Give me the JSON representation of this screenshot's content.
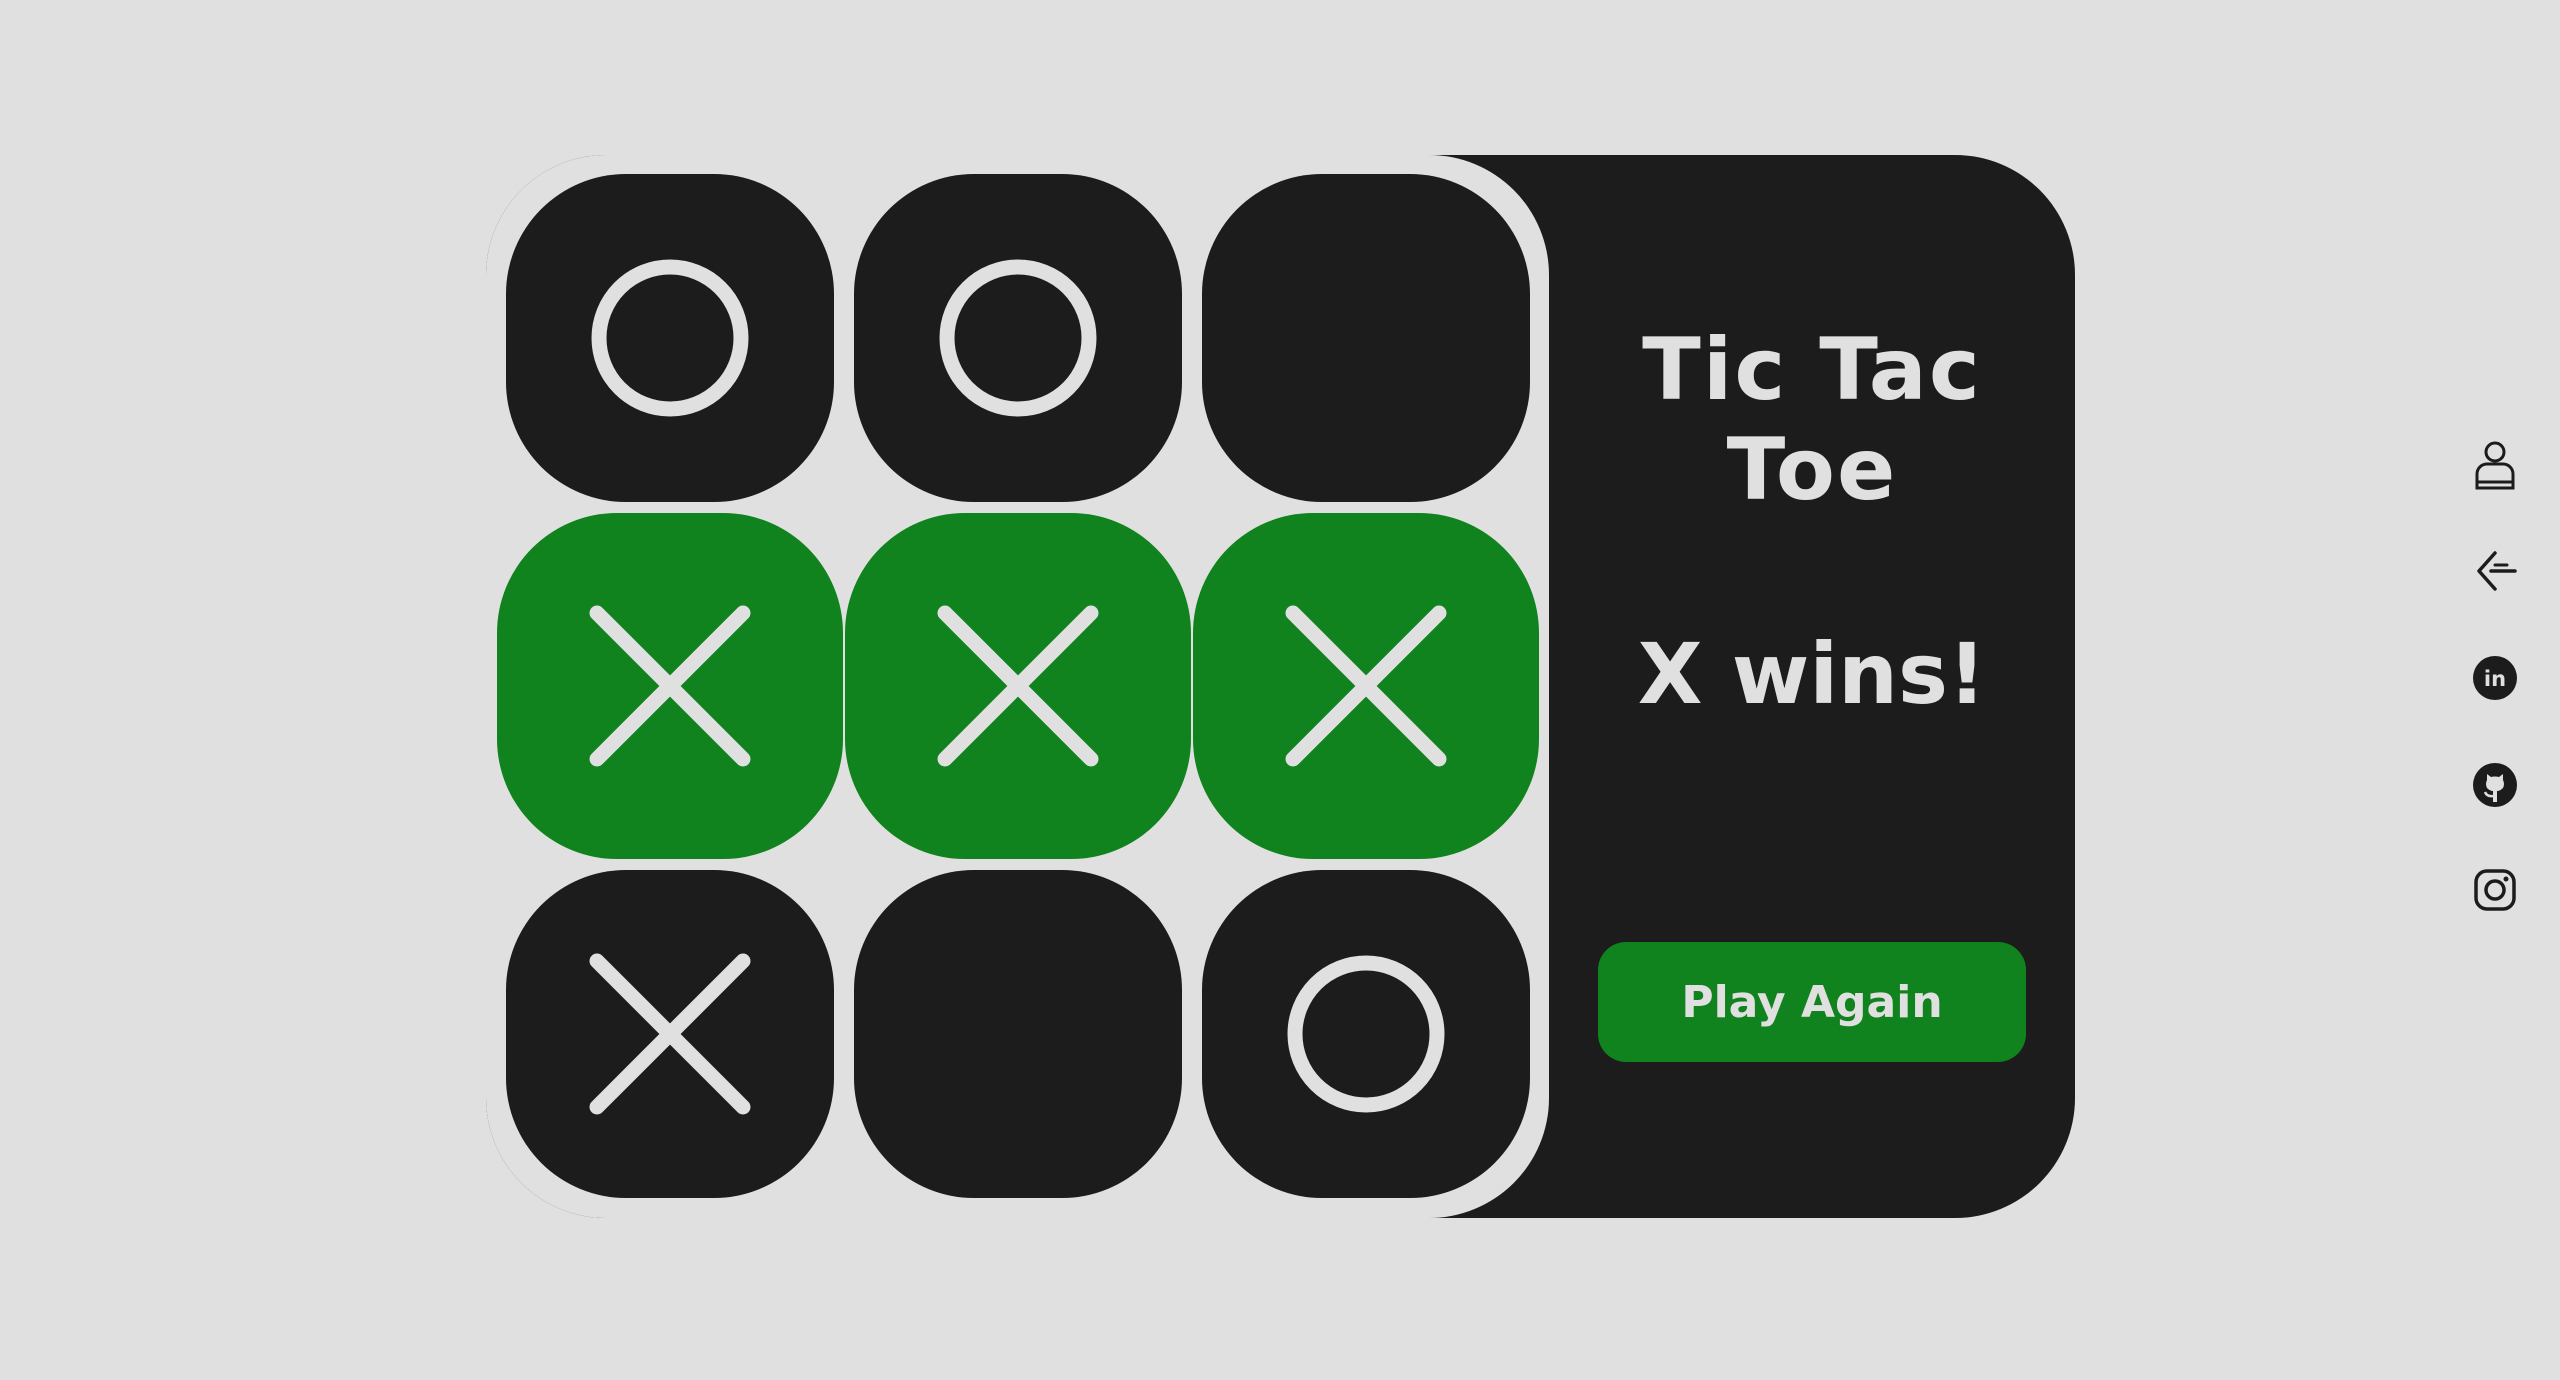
{
  "game": {
    "title": "Tic Tac Toe",
    "status": "X wins!",
    "play_again_label": "Play Again",
    "board": [
      "O",
      "O",
      "",
      "X",
      "X",
      "X",
      "X",
      "",
      "O"
    ],
    "winning_line": [
      3,
      4,
      5
    ]
  },
  "colors": {
    "background": "#e0e0e0",
    "cell": "#1c1c1c",
    "win": "#10821e",
    "mark": "#e0e0e0"
  },
  "social": [
    {
      "name": "profile",
      "icon": "user-icon"
    },
    {
      "name": "portfolio",
      "icon": "back-arrow-icon"
    },
    {
      "name": "linkedin",
      "icon": "linkedin-icon"
    },
    {
      "name": "github",
      "icon": "github-icon"
    },
    {
      "name": "instagram",
      "icon": "instagram-icon"
    }
  ]
}
